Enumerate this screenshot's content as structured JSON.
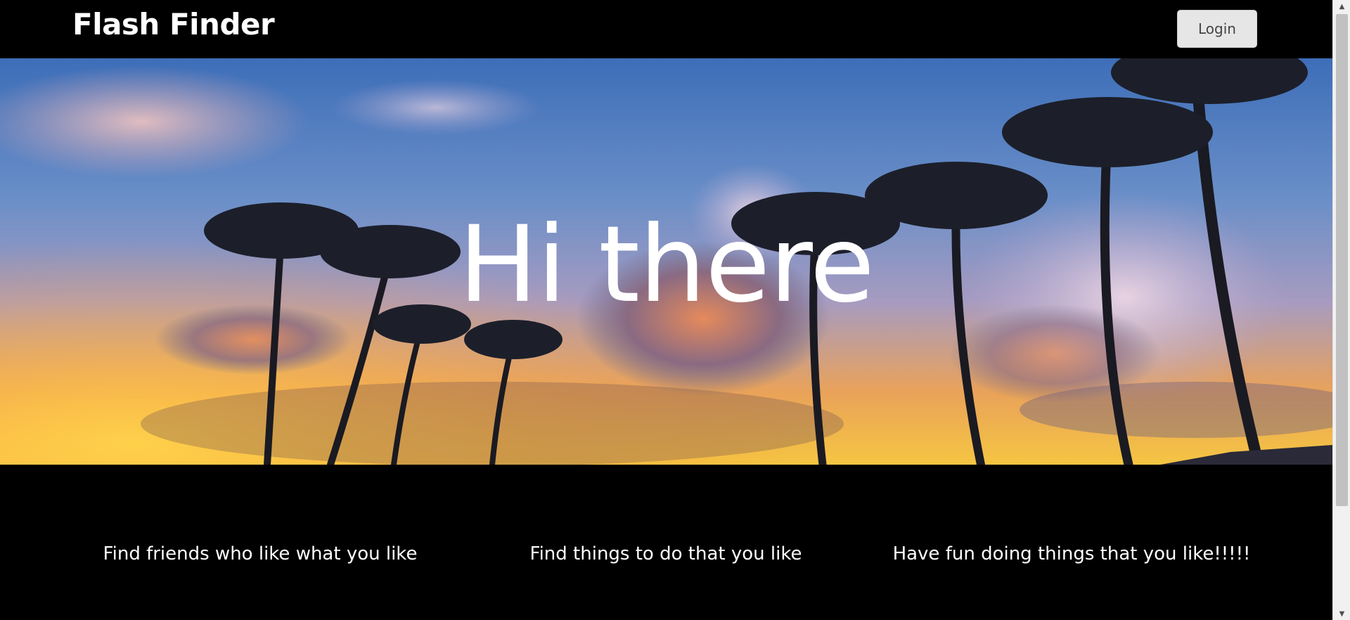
{
  "navbar": {
    "brand": "Flash Finder",
    "login_label": "Login"
  },
  "hero": {
    "title": "Hi there",
    "background": "sunset sky with palm trees"
  },
  "features": [
    {
      "text": "Find friends who like what you like"
    },
    {
      "text": "Find things to do that you like"
    },
    {
      "text": "Have fun doing things that you like!!!!!"
    }
  ],
  "colors": {
    "navbar_bg": "#000000",
    "page_bg": "#000000",
    "button_bg": "#e6e6e6",
    "text": "#ffffff"
  }
}
